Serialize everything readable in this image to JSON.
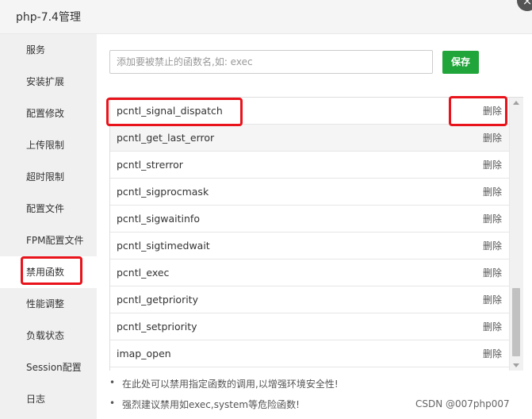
{
  "window": {
    "title": "php-7.4管理",
    "close_icon": "×"
  },
  "sidebar": {
    "items": [
      {
        "label": "服务"
      },
      {
        "label": "安装扩展"
      },
      {
        "label": "配置修改"
      },
      {
        "label": "上传限制"
      },
      {
        "label": "超时限制"
      },
      {
        "label": "配置文件"
      },
      {
        "label": "FPM配置文件"
      },
      {
        "label": "禁用函数"
      },
      {
        "label": "性能调整"
      },
      {
        "label": "负载状态"
      },
      {
        "label": "Session配置"
      },
      {
        "label": "日志"
      }
    ],
    "active_index": 7
  },
  "toolbar": {
    "search_placeholder": "添加要被禁止的函数名,如: exec",
    "save_label": "保存"
  },
  "functions": [
    {
      "name": "pcntl_signal_dispatch",
      "action": "删除"
    },
    {
      "name": "pcntl_get_last_error",
      "action": "删除"
    },
    {
      "name": "pcntl_strerror",
      "action": "删除"
    },
    {
      "name": "pcntl_sigprocmask",
      "action": "删除"
    },
    {
      "name": "pcntl_sigwaitinfo",
      "action": "删除"
    },
    {
      "name": "pcntl_sigtimedwait",
      "action": "删除"
    },
    {
      "name": "pcntl_exec",
      "action": "删除"
    },
    {
      "name": "pcntl_getpriority",
      "action": "删除"
    },
    {
      "name": "pcntl_setpriority",
      "action": "删除"
    },
    {
      "name": "imap_open",
      "action": "删除"
    }
  ],
  "tips": [
    {
      "bullet": "•",
      "text": "在此处可以禁用指定函数的调用,以增强环境安全性!"
    },
    {
      "bullet": "•",
      "text": "强烈建议禁用如exec,system等危险函数!"
    }
  ],
  "watermark": "CSDN @007php007",
  "colors": {
    "accent": "#20a53a",
    "highlight": "#e8131b"
  }
}
